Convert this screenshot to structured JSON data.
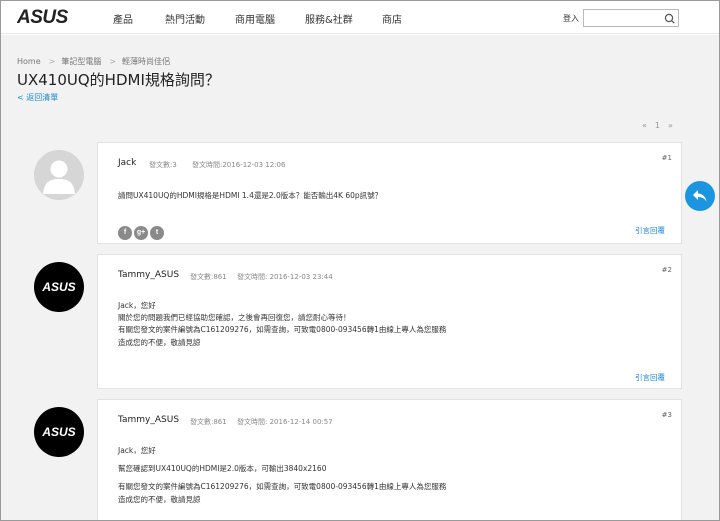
{
  "header": {
    "logo_text": "ASUS",
    "nav": [
      {
        "label": "產品"
      },
      {
        "label": "熱門活動"
      },
      {
        "label": "商用電腦"
      },
      {
        "label": "服務&社群"
      },
      {
        "label": "商店"
      }
    ],
    "login_label": "登入",
    "search_value": ""
  },
  "breadcrumb": [
    "Home",
    "筆記型電腦",
    "輕薄時尚佳侶"
  ],
  "page_title": "UX410UQ的HDMI規格詢問？",
  "back_link": "< 返回清單",
  "pager": {
    "prev": "«",
    "current": "1",
    "next": "»"
  },
  "posts": [
    {
      "author": "Jack",
      "post_count": "發文數:3",
      "post_time": "發文時間:2016-12-03 12:06",
      "number": "#1",
      "lines": [
        "請問UX410UQ的HDMI規格是HDMI 1.4還是2.0版本？能否輸出4K 60p訊號？"
      ],
      "reply": "引言回覆",
      "social": [
        "f",
        "g+",
        "t"
      ]
    },
    {
      "author": "Tammy_ASUS",
      "post_count": "發文數:861",
      "post_time": "發文時間: 2016-12-03 23:44",
      "number": "#2",
      "lines": [
        "Jack，您好",
        "關於您的問題我們已經協助您確認，之後會再回復您，請您耐心等待！",
        "有關您發文的案件編號為C161209276，如需查詢，可致電0800-093456轉1由線上專人為您服務",
        "造成您的不便，敬請見諒"
      ],
      "reply": "引言回覆"
    },
    {
      "author": "Tammy_ASUS",
      "post_count": "發文數:861",
      "post_time": "發文時間: 2016-12-14 00:57",
      "number": "#3",
      "lines": [
        "Jack，您好",
        "幫您確認到UX410UQ的HDMI是2.0版本，可輸出3840x2160",
        "有關您發文的案件編號為C161209276，如需查詢，可致電0800-093456轉1由線上專人為您服務",
        "造成您的不便，敬請見諒"
      ]
    }
  ],
  "colors": {
    "accent": "#1b87d6",
    "float_button": "#1b95e0",
    "background": "#f2f2f2"
  }
}
